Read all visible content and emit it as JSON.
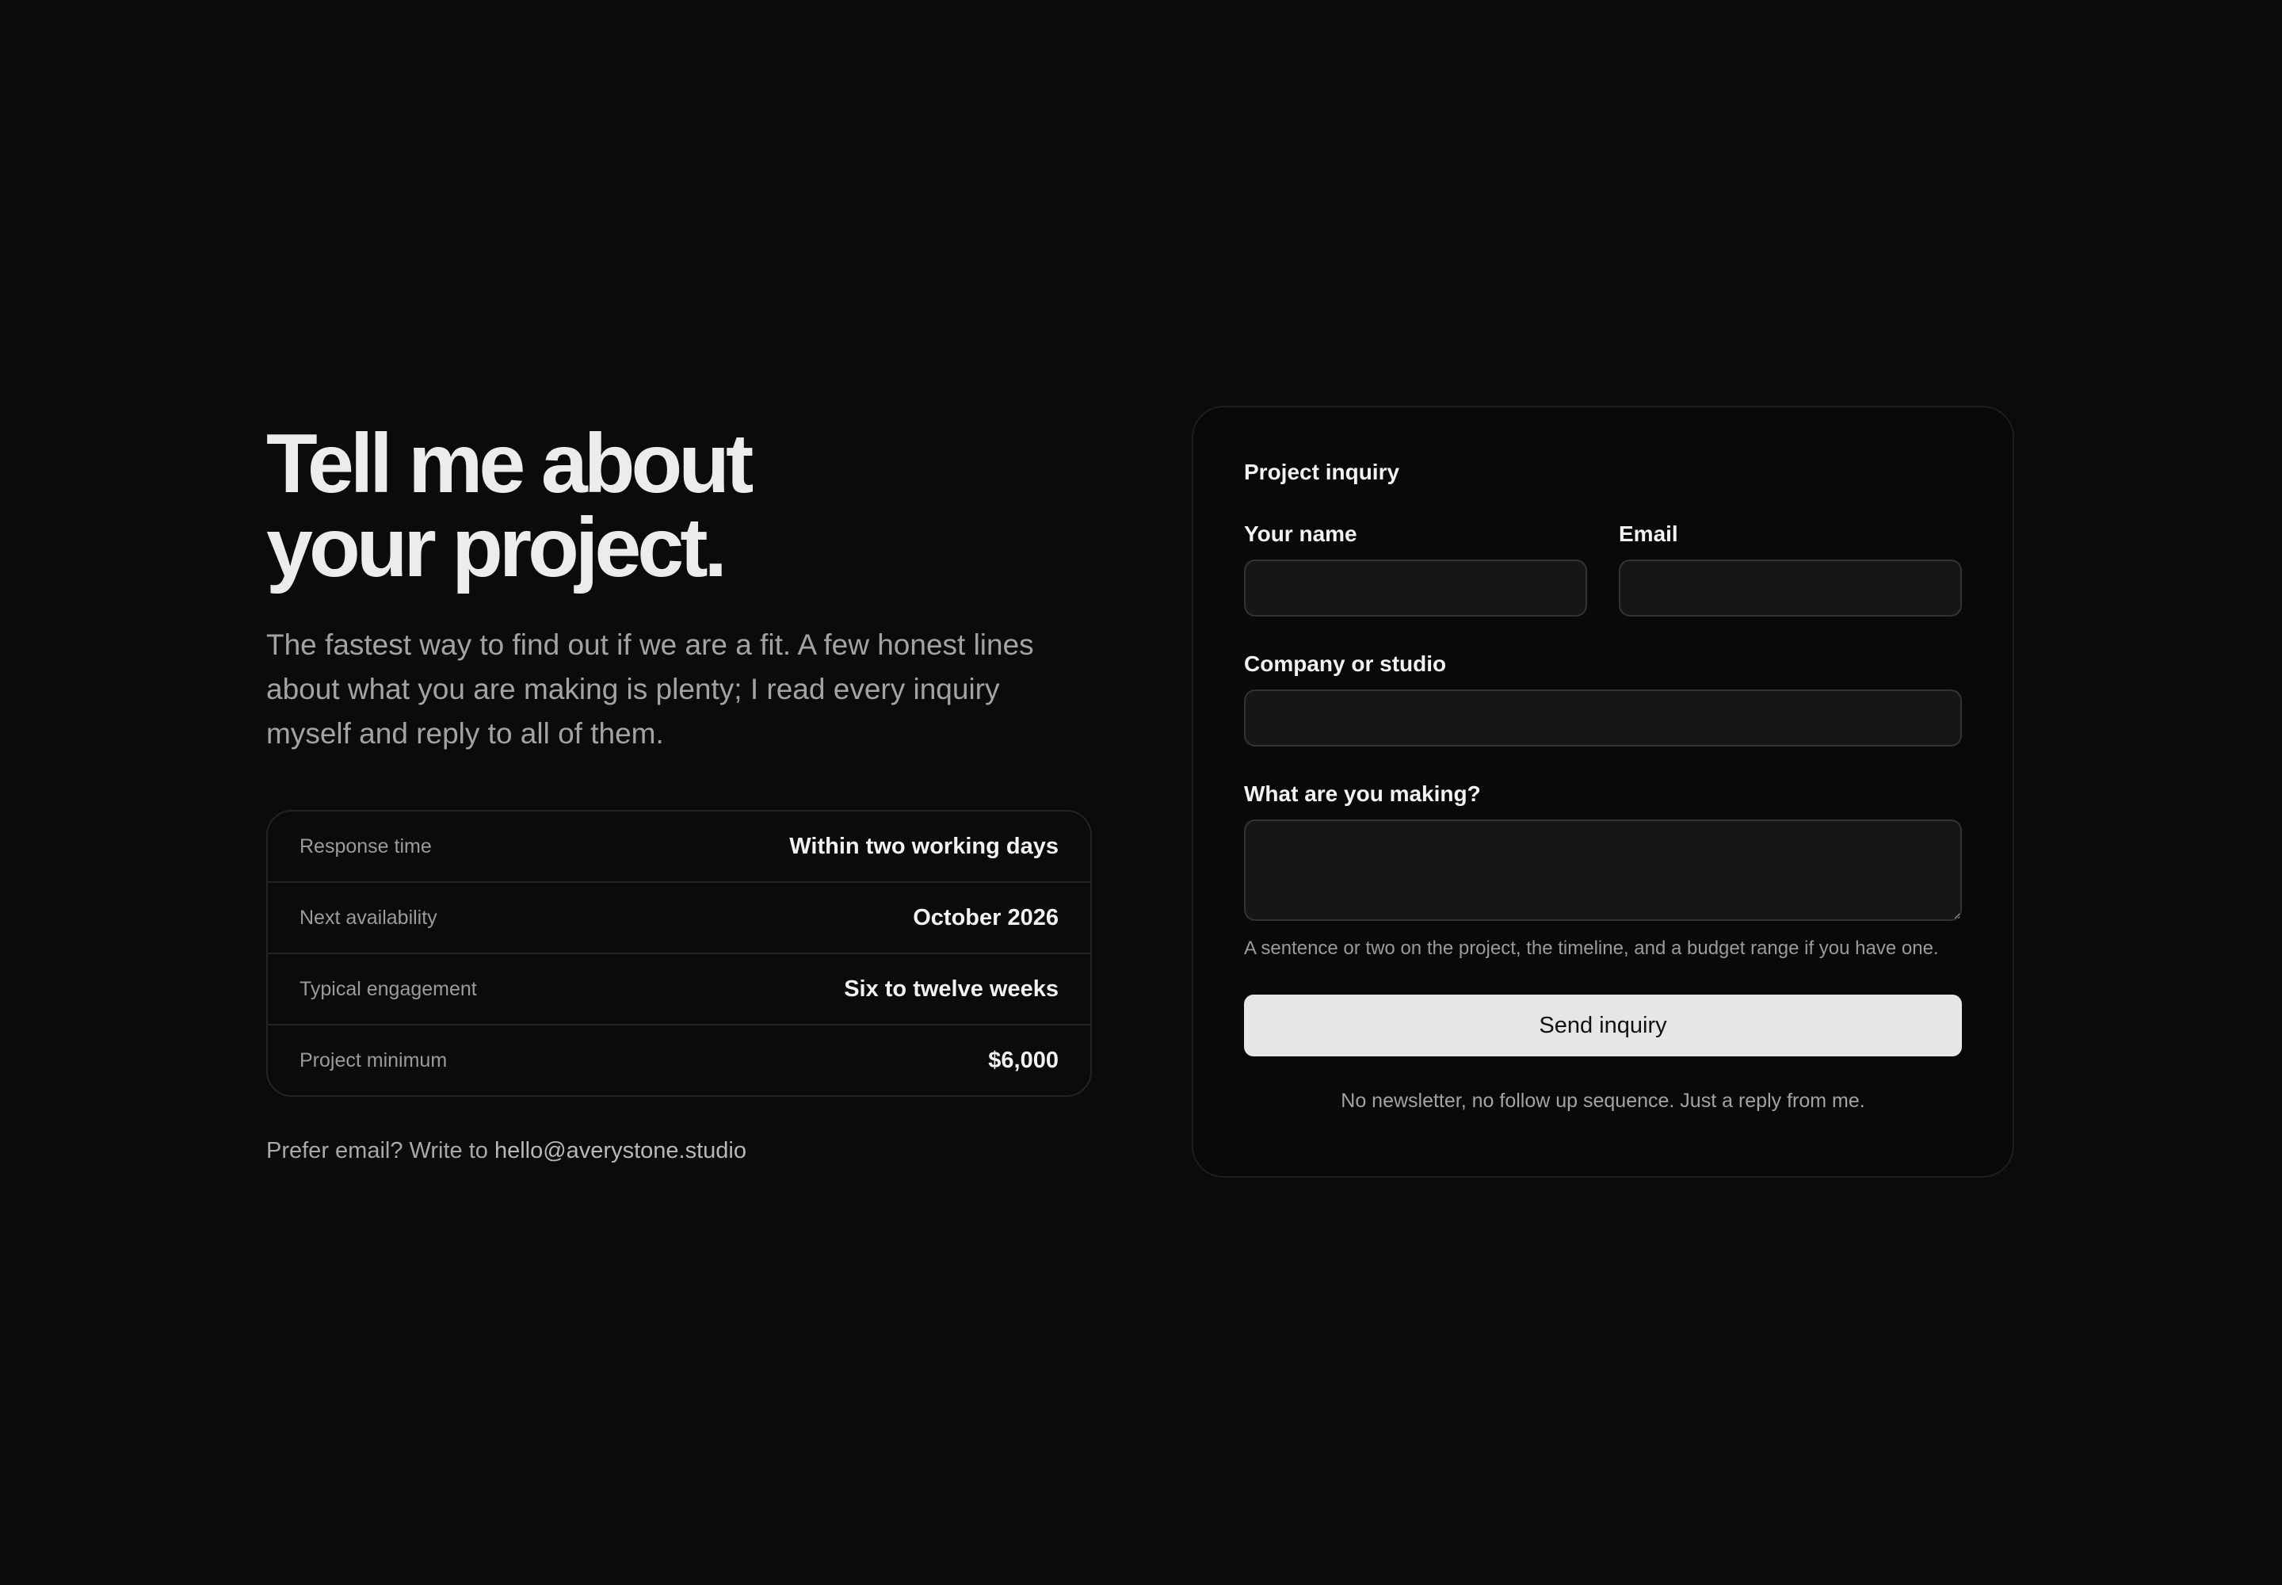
{
  "intro": {
    "headline_line1": "Tell me about",
    "headline_line2": "your project.",
    "lead": "The fastest way to find out if we are a fit. A few honest lines about what you are making is plenty; I read every inquiry myself and reply to all of them."
  },
  "facts": [
    {
      "label": "Response time",
      "value": "Within two working days"
    },
    {
      "label": "Next availability",
      "value": "October 2026"
    },
    {
      "label": "Typical engagement",
      "value": "Six to twelve weeks"
    },
    {
      "label": "Project minimum",
      "value": "$6,000"
    }
  ],
  "email_note": {
    "prefix": "Prefer email? Write to ",
    "address": "hello@averystone.studio"
  },
  "form": {
    "title": "Project inquiry",
    "name_label": "Your name",
    "name_value": "",
    "email_label": "Email",
    "email_value": "",
    "company_label": "Company or studio",
    "company_value": "",
    "making_label": "What are you making?",
    "making_value": "",
    "making_hint": "A sentence or two on the project, the timeline, and a budget range if you have one.",
    "submit_label": "Send inquiry",
    "footnote": "No newsletter, no follow up sequence. Just a reply from me."
  },
  "colors": {
    "background": "#0b0b0b",
    "card_background": "#090909",
    "input_background": "#161616",
    "button_background": "#e6e6e6",
    "muted_text": "#a3a3a3"
  }
}
